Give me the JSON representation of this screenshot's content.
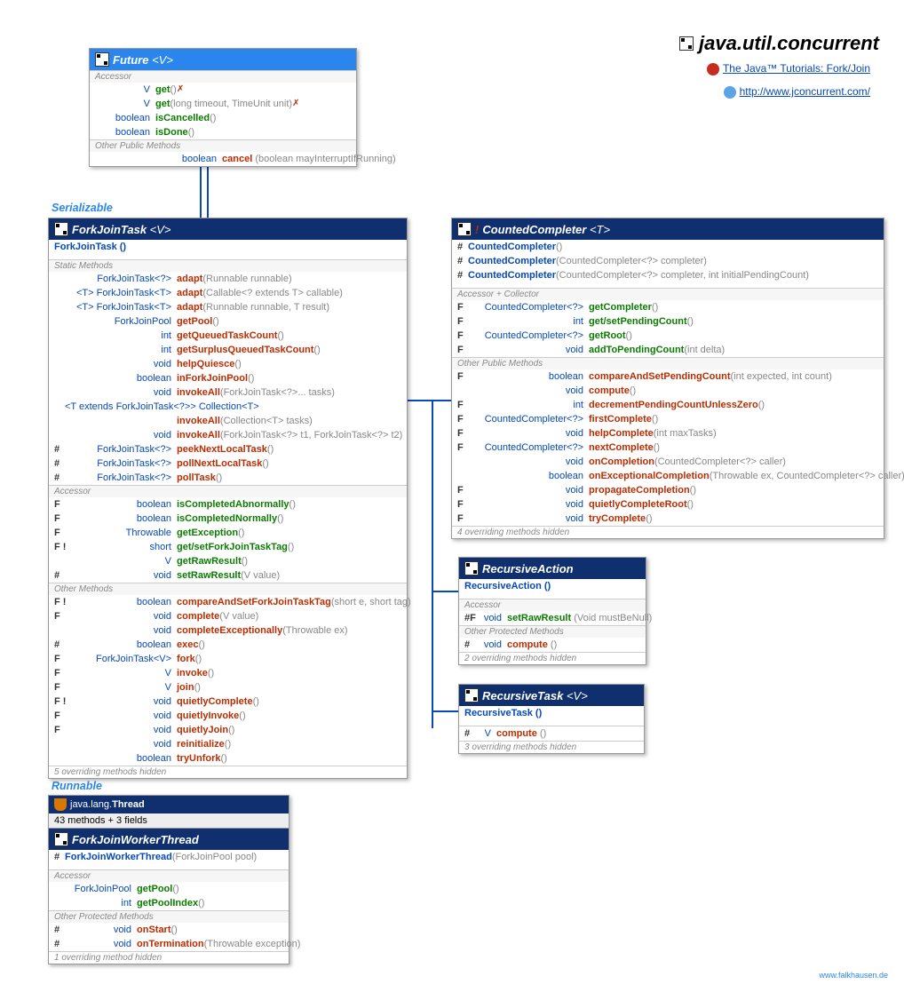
{
  "pageTitle": "java.util.concurrent",
  "linkTutorial": "The Java™ Tutorials: Fork/Join",
  "linkSite": "http://www.jconcurrent.com/",
  "attribution": "www.falkhausen.de",
  "annotSerializable": "Serializable",
  "annotRunnable": "Runnable",
  "future": {
    "title": "Future",
    "tp": "<V>",
    "secAccessor": "Accessor",
    "rows": [
      {
        "ret": "V",
        "name": "get",
        "params": "()",
        "exc": " ✗",
        "type": "acc"
      },
      {
        "ret": "V",
        "name": "get",
        "params": "(long timeout, TimeUnit unit)",
        "exc": " ✗",
        "type": "acc",
        "p2": [
          "timeout",
          "unit"
        ],
        "ptypes": [
          "long",
          "TimeUnit"
        ]
      },
      {
        "ret": "boolean",
        "name": "isCancelled",
        "params": "()",
        "type": "acc"
      },
      {
        "ret": "boolean",
        "name": "isDone",
        "params": "()",
        "type": "acc"
      }
    ],
    "secOther": "Other Public Methods",
    "rowCancel": {
      "ret": "boolean",
      "name": "cancel",
      "params": "(boolean mayInterruptIfRunning)",
      "type": "m"
    }
  },
  "fjt": {
    "title": "ForkJoinTask",
    "tp": "<V>",
    "ctor": "ForkJoinTask ()",
    "secStatic": "Static Methods",
    "staticRows": [
      {
        "mod": "",
        "ret": "ForkJoinTask<?>",
        "name": "adapt",
        "params": "(Runnable runnable)"
      },
      {
        "mod": "",
        "ret": "<T> ForkJoinTask<T>",
        "name": "adapt",
        "params": "(Callable<? extends T> callable)"
      },
      {
        "mod": "",
        "ret": "<T> ForkJoinTask<T>",
        "name": "adapt",
        "params": "(Runnable runnable, T result)"
      },
      {
        "mod": "",
        "ret": "ForkJoinPool",
        "name": "getPool",
        "params": "()"
      },
      {
        "mod": "",
        "ret": "int",
        "name": "getQueuedTaskCount",
        "params": "()"
      },
      {
        "mod": "",
        "ret": "int",
        "name": "getSurplusQueuedTaskCount",
        "params": "()"
      },
      {
        "mod": "",
        "ret": "void",
        "name": "helpQuiesce",
        "params": "()"
      },
      {
        "mod": "",
        "ret": "boolean",
        "name": "inForkJoinPool",
        "params": "()"
      },
      {
        "mod": "",
        "ret": "void",
        "name": "invokeAll",
        "params": "(ForkJoinTask<?>... tasks)"
      },
      {
        "mod": "",
        "ret": "<T extends ForkJoinTask<?>> Collection<T>"
      },
      {
        "mod": "",
        "ret": "",
        "name": "invokeAll",
        "params": "(Collection<T> tasks)"
      },
      {
        "mod": "",
        "ret": "void",
        "name": "invokeAll",
        "params": "(ForkJoinTask<?> t1, ForkJoinTask<?> t2)"
      },
      {
        "mod": "#",
        "ret": "ForkJoinTask<?>",
        "name": "peekNextLocalTask",
        "params": "()"
      },
      {
        "mod": "#",
        "ret": "ForkJoinTask<?>",
        "name": "pollNextLocalTask",
        "params": "()"
      },
      {
        "mod": "#",
        "ret": "ForkJoinTask<?>",
        "name": "pollTask",
        "params": "()"
      }
    ],
    "secAccessor": "Accessor",
    "accRows": [
      {
        "mod": "F",
        "ret": "boolean",
        "name": "isCompletedAbnormally",
        "params": "()",
        "type": "acc"
      },
      {
        "mod": "F",
        "ret": "boolean",
        "name": "isCompletedNormally",
        "params": "()",
        "type": "acc"
      },
      {
        "mod": "F",
        "ret": "Throwable",
        "name": "getException",
        "params": "()",
        "type": "acc"
      },
      {
        "mod": "F !",
        "ret": "short",
        "name": "get/setForkJoinTaskTag",
        "params": "()",
        "type": "acc"
      },
      {
        "mod": "",
        "ret": "V",
        "name": "getRawResult",
        "params": "()",
        "type": "acc"
      },
      {
        "mod": "#",
        "ret": "void",
        "name": "setRawResult",
        "params": "(V value)",
        "type": "acc"
      }
    ],
    "secOther": "Other Methods",
    "otherRows": [
      {
        "mod": "F !",
        "ret": "boolean",
        "name": "compareAndSetForkJoinTaskTag",
        "params": "(short e, short tag)"
      },
      {
        "mod": "F",
        "ret": "void",
        "name": "complete",
        "params": "(V value)"
      },
      {
        "mod": "",
        "ret": "void",
        "name": "completeExceptionally",
        "params": "(Throwable ex)"
      },
      {
        "mod": "#",
        "ret": "boolean",
        "name": "exec",
        "params": "()"
      },
      {
        "mod": "F",
        "ret": "ForkJoinTask<V>",
        "name": "fork",
        "params": "()"
      },
      {
        "mod": "F",
        "ret": "V",
        "name": "invoke",
        "params": "()"
      },
      {
        "mod": "F",
        "ret": "V",
        "name": "join",
        "params": "()"
      },
      {
        "mod": "F !",
        "ret": "void",
        "name": "quietlyComplete",
        "params": "()"
      },
      {
        "mod": "F",
        "ret": "void",
        "name": "quietlyInvoke",
        "params": "()"
      },
      {
        "mod": "F",
        "ret": "void",
        "name": "quietlyJoin",
        "params": "()"
      },
      {
        "mod": "",
        "ret": "void",
        "name": "reinitialize",
        "params": "()"
      },
      {
        "mod": "",
        "ret": "boolean",
        "name": "tryUnfork",
        "params": "()"
      }
    ],
    "footer": "5 overriding methods hidden"
  },
  "counted": {
    "title": "CountedCompleter",
    "tp": "<T>",
    "abstract": "!",
    "ctors": [
      {
        "mod": "#",
        "name": "CountedCompleter",
        "params": "()"
      },
      {
        "mod": "#",
        "name": "CountedCompleter",
        "params": "(CountedCompleter<?> completer)"
      },
      {
        "mod": "#",
        "name": "CountedCompleter",
        "params": "(CountedCompleter<?> completer, int initialPendingCount)"
      }
    ],
    "secAcc": "Accessor + Collector",
    "accRows": [
      {
        "mod": "F",
        "ret": "CountedCompleter<?>",
        "name": "getCompleter",
        "params": "()",
        "type": "acc"
      },
      {
        "mod": "F",
        "ret": "int",
        "name": "get/setPendingCount",
        "params": "()",
        "type": "acc"
      },
      {
        "mod": "F",
        "ret": "CountedCompleter<?>",
        "name": "getRoot",
        "params": "()",
        "type": "acc"
      },
      {
        "mod": "F",
        "ret": "void",
        "name": "addToPendingCount",
        "params": "(int delta)",
        "type": "acc"
      }
    ],
    "secOther": "Other Public Methods",
    "otherRows": [
      {
        "mod": "F",
        "ret": "boolean",
        "name": "compareAndSetPendingCount",
        "params": "(int expected, int count)"
      },
      {
        "mod": "",
        "ret": "void",
        "name": "compute",
        "params": "()"
      },
      {
        "mod": "F",
        "ret": "int",
        "name": "decrementPendingCountUnlessZero",
        "params": "()"
      },
      {
        "mod": "F",
        "ret": "CountedCompleter<?>",
        "name": "firstComplete",
        "params": "()"
      },
      {
        "mod": "F",
        "ret": "void",
        "name": "helpComplete",
        "params": "(int maxTasks)"
      },
      {
        "mod": "F",
        "ret": "CountedCompleter<?>",
        "name": "nextComplete",
        "params": "()"
      },
      {
        "mod": "",
        "ret": "void",
        "name": "onCompletion",
        "params": "(CountedCompleter<?> caller)"
      },
      {
        "mod": "",
        "ret": "boolean",
        "name": "onExceptionalCompletion",
        "params": "(Throwable ex, CountedCompleter<?> caller)"
      },
      {
        "mod": "F",
        "ret": "void",
        "name": "propagateCompletion",
        "params": "()"
      },
      {
        "mod": "F",
        "ret": "void",
        "name": "quietlyCompleteRoot",
        "params": "()"
      },
      {
        "mod": "F",
        "ret": "void",
        "name": "tryComplete",
        "params": "()"
      }
    ],
    "footer": "4 overriding methods hidden"
  },
  "recAction": {
    "title": "RecursiveAction",
    "ctor": "RecursiveAction ()",
    "secAcc": "Accessor",
    "acc": {
      "mod": "#F",
      "ret": "void",
      "name": "setRawResult",
      "params": "(Void mustBeNull)"
    },
    "secProt": "Other Protected Methods",
    "prot": {
      "mod": "#",
      "ret": "void",
      "name": "compute",
      "params": "()"
    },
    "footer": "2 overriding methods hidden"
  },
  "recTask": {
    "title": "RecursiveTask",
    "tp": "<V>",
    "ctor": "RecursiveTask ()",
    "row": {
      "mod": "#",
      "ret": "V",
      "name": "compute",
      "params": "()"
    },
    "footer": "3 overriding methods hidden"
  },
  "thread": {
    "pkg": "java.lang.",
    "name": "Thread",
    "summary": "43 methods + 3 fields"
  },
  "fjwt": {
    "title": "ForkJoinWorkerThread",
    "ctor": {
      "mod": "#",
      "name": "ForkJoinWorkerThread",
      "params": "(ForkJoinPool pool)"
    },
    "secAcc": "Accessor",
    "accRows": [
      {
        "ret": "ForkJoinPool",
        "name": "getPool",
        "params": "()"
      },
      {
        "ret": "int",
        "name": "getPoolIndex",
        "params": "()"
      }
    ],
    "secProt": "Other Protected Methods",
    "protRows": [
      {
        "mod": "#",
        "ret": "void",
        "name": "onStart",
        "params": "()"
      },
      {
        "mod": "#",
        "ret": "void",
        "name": "onTermination",
        "params": "(Throwable exception)"
      }
    ],
    "footer": "1 overriding method hidden"
  }
}
